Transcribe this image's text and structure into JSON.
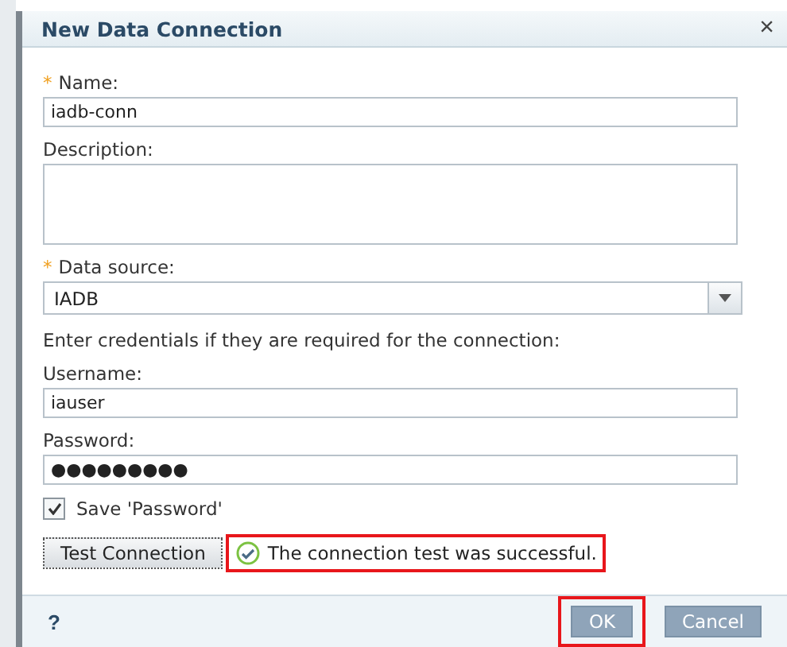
{
  "window": {
    "title": "New Data Connection",
    "close": "×"
  },
  "fields": [
    {
      "kind": "text",
      "marker": "*",
      "label": "Name:",
      "value": "iadb-conn"
    },
    {
      "kind": "textarea",
      "label": "Description:"
    },
    {
      "kind": "select",
      "marker": "*",
      "label": "Data source:",
      "value": "IADB"
    },
    {
      "kind": "note",
      "label": "Enter credentials if they are required for the connection:"
    },
    {
      "kind": "text",
      "label": "Username:",
      "value": "iauser"
    },
    {
      "kind": "text",
      "label": "Password:",
      "value": "●●●●●●●●●"
    }
  ],
  "save_password": {
    "label": "Save 'Password'",
    "checked": true
  },
  "test": {
    "button": "Test Connection",
    "status": "The connection test was successful.",
    "highlighted": true
  },
  "footer": {
    "help": "?",
    "buttons": [
      {
        "label": "OK",
        "highlighted": true
      },
      {
        "label": "Cancel",
        "highlighted": false
      }
    ]
  }
}
